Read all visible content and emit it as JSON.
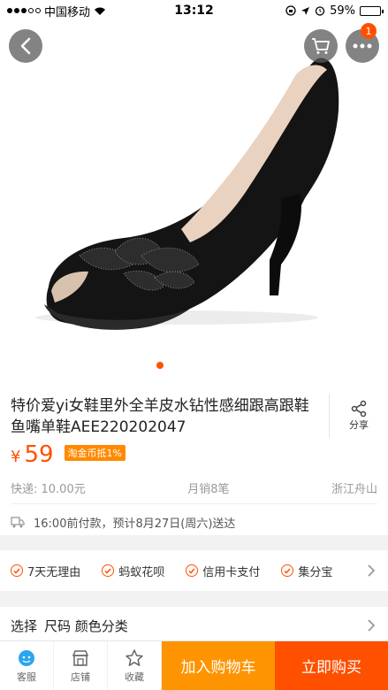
{
  "status_bar": {
    "carrier": "中国移动",
    "time": "13:12",
    "battery": "59%",
    "battery_level": 0.59
  },
  "header": {
    "cart_badge": "1"
  },
  "product": {
    "title": "特价爱yi女鞋里外全羊皮水钻性感细跟高跟鞋鱼嘴单鞋AEE220202047",
    "share_label": "分享",
    "price_symbol": "¥",
    "price": "59",
    "coin_tag": "淘金币抵1%",
    "shipping": "快递: 10.00元",
    "monthly_sales": "月销8笔",
    "location": "浙江舟山",
    "delivery_note": "16:00前付款，预计8月27日(周六)送达"
  },
  "services": [
    {
      "label": "7天无理由"
    },
    {
      "label": "蚂蚁花呗"
    },
    {
      "label": "信用卡支付"
    },
    {
      "label": "集分宝"
    }
  ],
  "select": {
    "label": "选择",
    "options": "尺码 颜色分类"
  },
  "bottom_bar": {
    "service_label": "客服",
    "shop_label": "店铺",
    "favorite_label": "收藏",
    "add_to_cart": "加入购物车",
    "buy_now": "立即购买"
  },
  "colors": {
    "accent": "#ff5000",
    "cart_button": "#ff9402"
  }
}
